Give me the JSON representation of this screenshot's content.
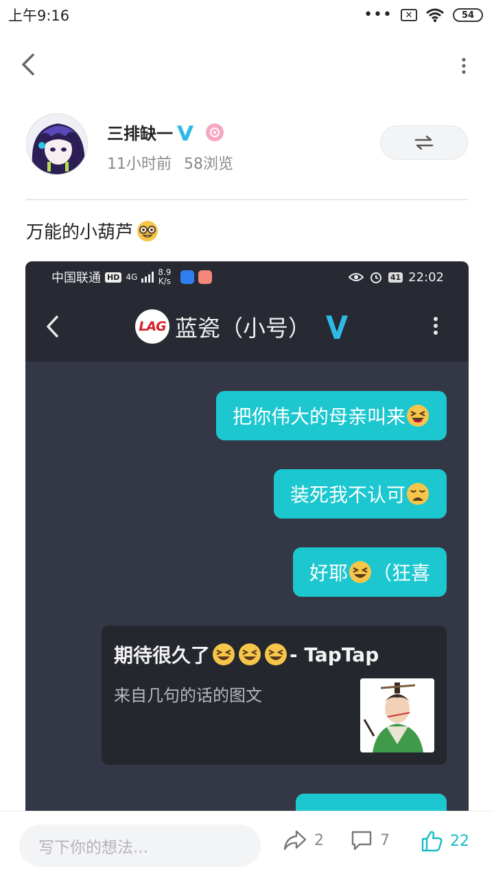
{
  "status_bar": {
    "time": "上午9:16",
    "dots": "•••",
    "battery": "54"
  },
  "author": {
    "name": "三排缺一",
    "time_ago": "11小时前",
    "views": "58浏览"
  },
  "post": {
    "text": "万能的小葫芦"
  },
  "screenshot": {
    "status": {
      "carrier": "中国联通",
      "hd": "HD",
      "net": "4G",
      "speed_top": "8.9",
      "speed_bottom": "K/s",
      "battery": "41",
      "time": "22:02"
    },
    "chat_title": "蓝瓷（小号）",
    "logo_text": "LAG",
    "messages": [
      {
        "text": "把你伟大的母亲叫来",
        "emoji": "laughing"
      },
      {
        "text": "装死我不认可",
        "emoji": "weary"
      },
      {
        "text_before": "好耶",
        "emoji": "laughing",
        "text_after": "（狂喜"
      }
    ],
    "card": {
      "title_before": "期待很久了",
      "title_after": " - TapTap",
      "subtitle": "来自几句的话的图文"
    }
  },
  "bottom_bar": {
    "placeholder": "写下你的想法...",
    "share_count": "2",
    "comment_count": "7",
    "like_count": "22"
  },
  "colors": {
    "accent": "#14bcc4",
    "bubble": "#1cc7cf",
    "chat_bg": "#343746",
    "chat_header": "#272933"
  }
}
